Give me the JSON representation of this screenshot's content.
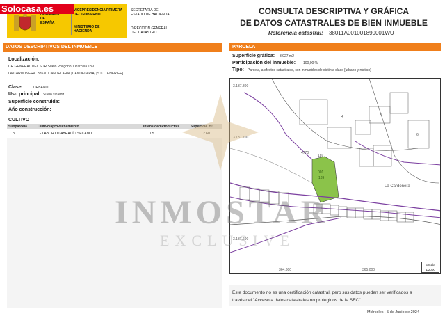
{
  "badge": "Solocasa.es",
  "gov": {
    "vice": "VICEPRESIDENCIA PRIMERA DEL GOBIERNO",
    "gobierno": "GOBIERNO DE ESPAÑA",
    "ministerio": "MINISTERIO DE HACIENDA",
    "secretaria": "SECRETARÍA DE ESTADO DE HACIENDA",
    "direccion": "DIRECCIÓN GENERAL DEL CATASTRO"
  },
  "title": {
    "line1": "CONSULTA DESCRIPTIVA Y GRÁFICA",
    "line2": "DE DATOS CATASTRALES DE BIEN INMUEBLE",
    "ref_label": "Referencia catastral:",
    "ref_value": "38011A001001890001WU"
  },
  "left": {
    "section_title": "DATOS DESCRIPTIVOS DEL INMUEBLE",
    "localizacion_label": "Localización:",
    "localizacion_line1": "CR GENERAL DEL SUR Suelo Polígono 1 Parcela 189",
    "localizacion_line2": "LA CARDONERA. 38530 CANDELARIA [CANDELARIA] [S.C. TENERIFE]",
    "clase_label": "Clase:",
    "clase_value": "URBANO",
    "uso_label": "Uso principal:",
    "uso_value": "Suelo sin edif.",
    "superficie_label": "Superficie construida:",
    "anio_label": "Año construcción:",
    "cultivo_label": "CULTIVO",
    "table": {
      "headers": [
        "Subparcela",
        "Cultivo/aprovechamiento",
        "Intensidad Productiva",
        "Superficie m²"
      ],
      "rows": [
        [
          "b",
          "C- LABOR O LABRADÍO SECANO",
          "05",
          "2.601"
        ]
      ]
    }
  },
  "right": {
    "section_title": "PARCELA",
    "superficie_label": "Superficie gráfica:",
    "superficie_value": "3.927 m2",
    "participacion_label": "Participación del inmueble:",
    "participacion_value": "100,00 %",
    "tipo_label": "Tipo:",
    "tipo_value": "Parcela, a efectos catastrales, con inmuebles de distinta clase [urbano y rústico]"
  },
  "map": {
    "labels": {
      "y1": "3.137.800",
      "y2": "3.137.700",
      "y3": "3.137.600",
      "x1": "364.800",
      "x2": "365.000",
      "parcel1": "001",
      "parcel2": "189",
      "place": "La Cardonera",
      "area1": "4",
      "area2": "8",
      "area3": "6",
      "area4": "189",
      "area5": "4770"
    },
    "scale_label": "Escala",
    "scale_value": "1/2000",
    "green": "#8bc34a",
    "purple": "#7b3fa0"
  },
  "notice": {
    "line1": "Este documento no es una certificación catastral, pero sus datos pueden ser verificados a",
    "line2": "través del \"Acceso a datos catastrales no protegidos de la SEC\""
  },
  "date": "Miércoles , 5 de Junio de 2024",
  "watermark": {
    "main": "INMOSTAR",
    "sub": "EXCLUSIVE"
  }
}
